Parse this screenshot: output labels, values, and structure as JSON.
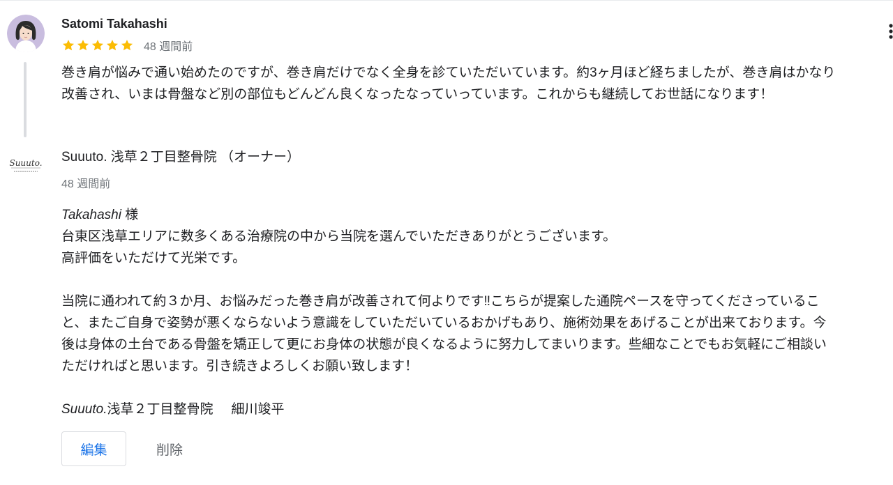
{
  "review": {
    "reviewer_name": "Satomi Takahashi",
    "rating": 5,
    "rating_max": 5,
    "time_ago": "48 週間前",
    "text": "巻き肩が悩みで通い始めたのですが、巻き肩だけでなく全身を診ていただいています。約3ヶ月ほど経ちましたが、巻き肩はかなり改善され、いまは骨盤など別の部位もどんどん良くなったなっていっています。これからも継続してお世話になります！",
    "avatar_icon": "woman-avatar-icon",
    "star_color": "#fbbc04"
  },
  "owner_reply": {
    "owner_name": "Suuuto. 浅草２丁目整骨院 （オーナー）",
    "logo_text": "Suuuto.",
    "time_ago": "48 週間前",
    "salutation_name": "Takahashi",
    "salutation_suffix": " 様",
    "paragraph1_line1": "台東区浅草エリアに数多くある治療院の中から当院を選んでいただきありがとうございます。",
    "paragraph1_line2": "高評価をいただけて光栄です。",
    "paragraph2": "当院に通われて約３か月、お悩みだった巻き肩が改善されて何よりです‼こちらが提案した通院ペースを守ってくださっていること、またご自身で姿勢が悪くならないよう意識をしていただいているおかげもあり、施術効果をあげることが出来ております。今後は身体の土台である骨盤を矯正して更にお身体の状態が良くなるように努力してまいります。些細なことでもお気軽にご相談いただければと思います。引き続きよろしくお願い致します！",
    "signature_brand": "Suuuto.",
    "signature_clinic": "浅草２丁目整骨院",
    "signature_person": "細川竣平"
  },
  "actions": {
    "edit_label": "編集",
    "delete_label": "削除",
    "more_icon": "more-vert-icon"
  },
  "colors": {
    "accent": "#1a73e8",
    "secondary_text": "#70757a",
    "divider": "#dadce0"
  }
}
